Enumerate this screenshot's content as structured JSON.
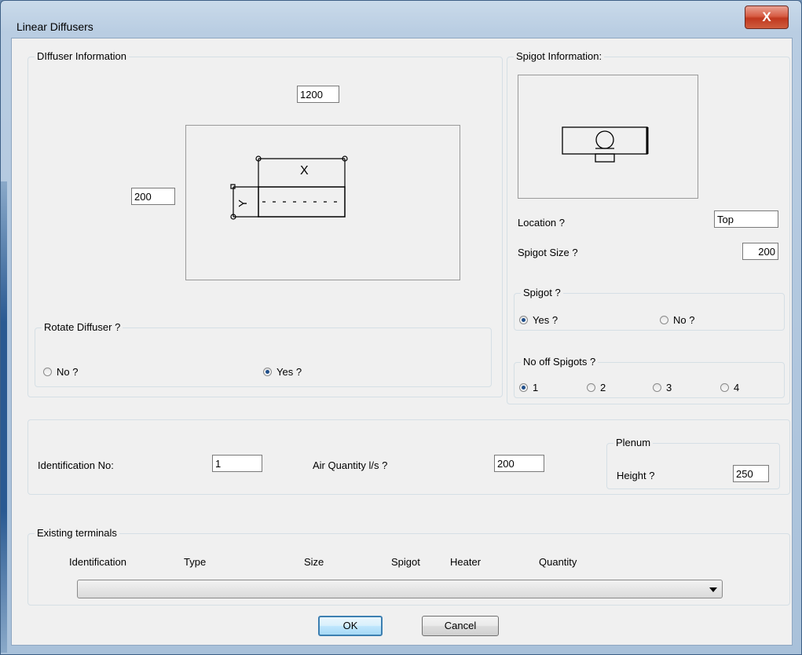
{
  "window": {
    "title": "Linear Diffusers",
    "close_label": "X"
  },
  "diffuser_info": {
    "legend": "DIffuser Information",
    "length_value": "1200",
    "width_value": "200",
    "diagram": {
      "x_label": "X",
      "y_label": "Y"
    }
  },
  "rotate": {
    "legend": "Rotate Diffuser ?",
    "options": [
      {
        "label": "No ?",
        "selected": false
      },
      {
        "label": "Yes ?",
        "selected": true
      }
    ]
  },
  "spigot_info": {
    "legend": "Spigot Information:",
    "location_label": "Location ?",
    "location_value": "Top",
    "size_label": "Spigot Size ?",
    "size_value": "200"
  },
  "spigot": {
    "legend": "Spigot ?",
    "options": [
      {
        "label": "Yes ?",
        "selected": true
      },
      {
        "label": "No ?",
        "selected": false
      }
    ]
  },
  "num_spigots": {
    "legend": "No off Spigots ?",
    "options": [
      {
        "label": "1",
        "selected": true
      },
      {
        "label": "2",
        "selected": false
      },
      {
        "label": "3",
        "selected": false
      },
      {
        "label": "4",
        "selected": false
      }
    ]
  },
  "details": {
    "id_label": "Identification No:",
    "id_value": "1",
    "air_label": "Air Quantity l/s ?",
    "air_value": "200"
  },
  "plenum": {
    "legend": "Plenum",
    "height_label": "Height ?",
    "height_value": "250"
  },
  "existing": {
    "legend": "Existing terminals",
    "columns": [
      "Identification",
      "Type",
      "Size",
      "Spigot",
      "Heater",
      "Quantity"
    ],
    "selected_value": ""
  },
  "buttons": {
    "ok": "OK",
    "cancel": "Cancel"
  }
}
